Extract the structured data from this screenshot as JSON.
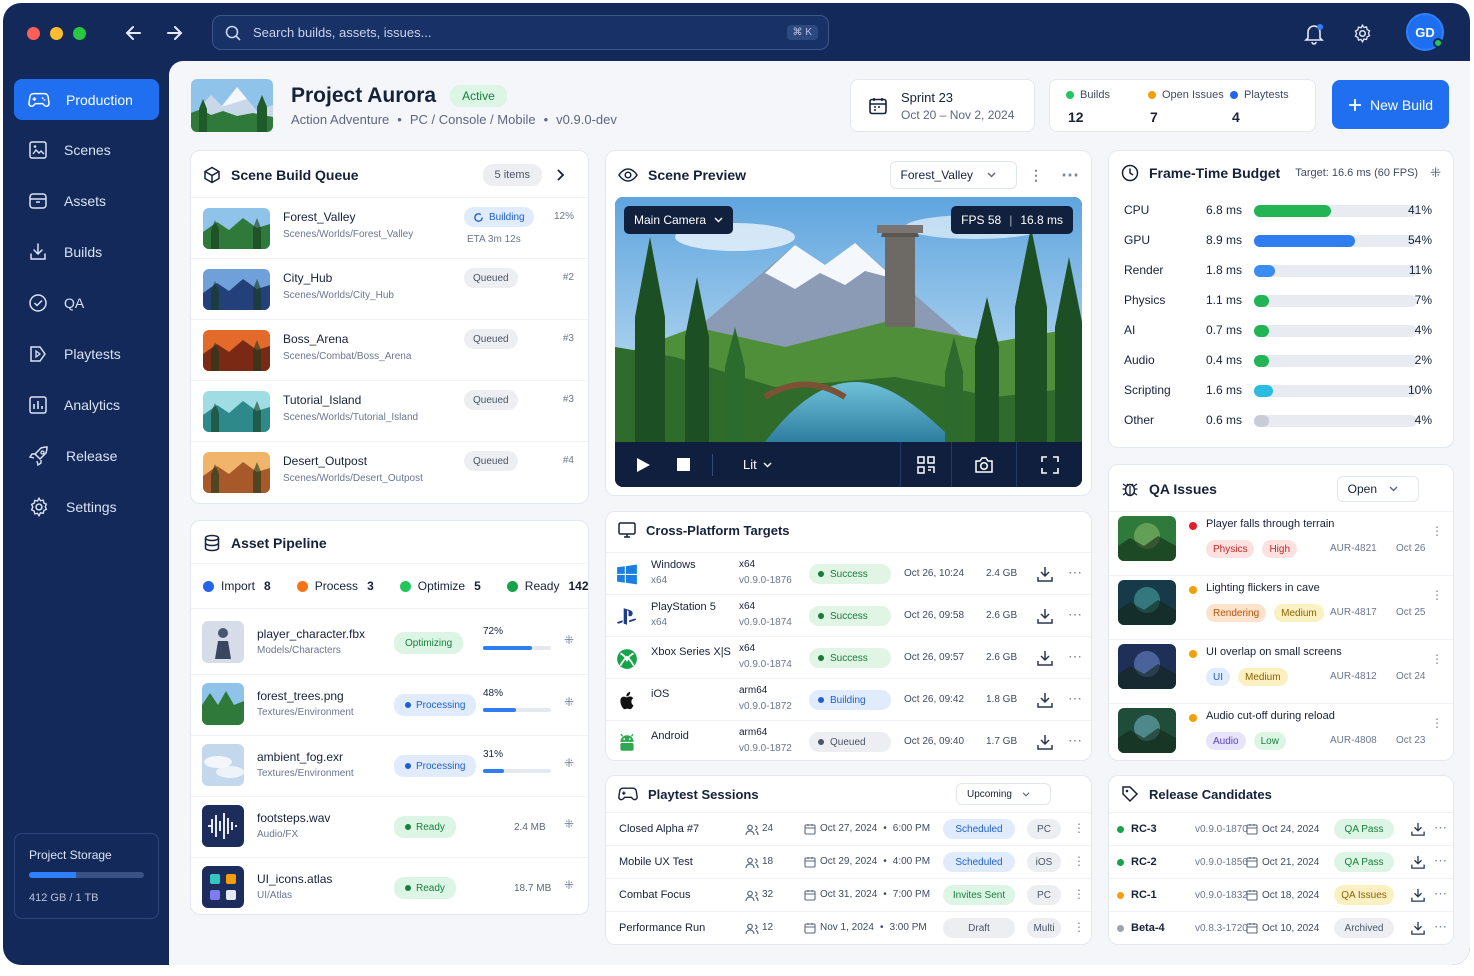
{
  "window": {
    "dot_colors": [
      "#ff5f57",
      "#febc2e",
      "#28c840"
    ]
  },
  "search": {
    "placeholder": "Search builds, assets, issues...",
    "shortcut": "⌘ K"
  },
  "user": {
    "initials": "GD"
  },
  "sidebar": {
    "items": [
      {
        "label": "Production",
        "icon": "gamepad-icon"
      },
      {
        "label": "Scenes",
        "icon": "scenes-icon"
      },
      {
        "label": "Assets",
        "icon": "assets-icon"
      },
      {
        "label": "Builds",
        "icon": "builds-icon"
      },
      {
        "label": "QA",
        "icon": "qa-icon"
      },
      {
        "label": "Playtests",
        "icon": "playtests-icon"
      },
      {
        "label": "Analytics",
        "icon": "analytics-icon"
      },
      {
        "label": "Release",
        "icon": "rocket-icon"
      },
      {
        "label": "Settings",
        "icon": "gear-icon"
      }
    ],
    "storage": {
      "label": "Project Storage",
      "value": "412 GB / 1 TB",
      "fraction": 0.412
    }
  },
  "project": {
    "name": "Project Aurora",
    "status": "Active",
    "genre": "Action Adventure",
    "platforms": "PC / Console / Mobile",
    "version": "v0.9.0-dev"
  },
  "sprint": {
    "name": "Sprint 23",
    "dates": "Oct 20 – Nov 2, 2024"
  },
  "stats": [
    {
      "label": "Builds",
      "value": "12",
      "color": "#22c55e"
    },
    {
      "label": "Open Issues",
      "value": "7",
      "color": "#f59e0b"
    },
    {
      "label": "Playtests",
      "value": "4",
      "color": "#2563eb"
    }
  ],
  "new_build": "New Build",
  "queue": {
    "title": "Scene Build Queue",
    "count": "5 items",
    "items": [
      {
        "name": "Forest_Valley",
        "path": "Scenes/Worlds/Forest_Valley",
        "status": "Building",
        "meta": "12%",
        "eta": "ETA 3m 12s"
      },
      {
        "name": "City_Hub",
        "path": "Scenes/Worlds/City_Hub",
        "status": "Queued",
        "meta": "#2",
        "eta": ""
      },
      {
        "name": "Boss_Arena",
        "path": "Scenes/Combat/Boss_Arena",
        "status": "Queued",
        "meta": "#3",
        "eta": ""
      },
      {
        "name": "Tutorial_Island",
        "path": "Scenes/Worlds/Tutorial_Island",
        "status": "Queued",
        "meta": "#3",
        "eta": ""
      },
      {
        "name": "Desert_Outpost",
        "path": "Scenes/Worlds/Desert_Outpost",
        "status": "Queued",
        "meta": "#4",
        "eta": ""
      }
    ]
  },
  "preview": {
    "title": "Scene Preview",
    "scene": "Forest_Valley",
    "camera": "Main Camera",
    "fps": "FPS 58",
    "ms": "16.8 ms",
    "mode": "Lit"
  },
  "budget": {
    "title": "Frame-Time Budget",
    "target": "Target: 16.6 ms (60 FPS)",
    "rows": [
      {
        "label": "CPU",
        "ms": "6.8 ms",
        "pct": "41%",
        "frac": 0.41,
        "color": "#22b455"
      },
      {
        "label": "GPU",
        "ms": "8.9 ms",
        "pct": "54%",
        "frac": 0.54,
        "color": "#2f7df0"
      },
      {
        "label": "Render",
        "ms": "1.8 ms",
        "pct": "11%",
        "frac": 0.11,
        "color": "#3b8cf5"
      },
      {
        "label": "Physics",
        "ms": "1.1 ms",
        "pct": "7%",
        "frac": 0.07,
        "color": "#22b455"
      },
      {
        "label": "AI",
        "ms": "0.7 ms",
        "pct": "4%",
        "frac": 0.04,
        "color": "#22b455"
      },
      {
        "label": "Audio",
        "ms": "0.4 ms",
        "pct": "2%",
        "frac": 0.02,
        "color": "#22b455"
      },
      {
        "label": "Scripting",
        "ms": "1.6 ms",
        "pct": "10%",
        "frac": 0.1,
        "color": "#2bbde0"
      },
      {
        "label": "Other",
        "ms": "0.6 ms",
        "pct": "4%",
        "frac": 0.04,
        "color": "#c8ccd6"
      }
    ]
  },
  "pipeline": {
    "title": "Asset Pipeline",
    "stages": [
      {
        "label": "Import",
        "count": "8",
        "color": "#2563eb"
      },
      {
        "label": "Process",
        "count": "3",
        "color": "#f97316"
      },
      {
        "label": "Optimize",
        "count": "5",
        "color": "#22c55e"
      },
      {
        "label": "Ready",
        "count": "142",
        "color": "#16a34a"
      }
    ],
    "items": [
      {
        "name": "player_character.fbx",
        "path": "Models/Characters",
        "status": "Optimizing",
        "pct": "72%",
        "frac": 0.72,
        "size": ""
      },
      {
        "name": "forest_trees.png",
        "path": "Textures/Environment",
        "status": "Processing",
        "pct": "48%",
        "frac": 0.48,
        "size": ""
      },
      {
        "name": "ambient_fog.exr",
        "path": "Textures/Environment",
        "status": "Processing",
        "pct": "31%",
        "frac": 0.31,
        "size": ""
      },
      {
        "name": "footsteps.wav",
        "path": "Audio/FX",
        "status": "Ready",
        "pct": "",
        "frac": 0,
        "size": "2.4 MB"
      },
      {
        "name": "UI_icons.atlas",
        "path": "UI/Atlas",
        "status": "Ready",
        "pct": "",
        "frac": 0,
        "size": "18.7 MB"
      }
    ]
  },
  "targets": {
    "title": "Cross-Platform Targets",
    "rows": [
      {
        "platform": "Windows",
        "sub": "x64",
        "arch": "x64",
        "build": "v0.9.0-1876",
        "status": "Success",
        "time": "Oct 26, 10:24",
        "size": "2.4 GB",
        "icon": "windows-icon"
      },
      {
        "platform": "PlayStation 5",
        "sub": "x64",
        "arch": "x64",
        "build": "v0.9.0-1874",
        "status": "Success",
        "time": "Oct 26, 09:58",
        "size": "2.6 GB",
        "icon": "playstation-icon"
      },
      {
        "platform": "Xbox Series X|S",
        "sub": "",
        "arch": "x64",
        "build": "v0.9.0-1874",
        "status": "Success",
        "time": "Oct 26, 09:57",
        "size": "2.6 GB",
        "icon": "xbox-icon"
      },
      {
        "platform": "iOS",
        "sub": "",
        "arch": "arm64",
        "build": "v0.9.0-1872",
        "status": "Building",
        "time": "Oct 26, 09:42",
        "size": "1.8 GB",
        "icon": "apple-icon"
      },
      {
        "platform": "Android",
        "sub": "",
        "arch": "arm64",
        "build": "v0.9.0-1872",
        "status": "Queued",
        "time": "Oct 26, 09:40",
        "size": "1.7 GB",
        "icon": "android-icon"
      }
    ]
  },
  "qa": {
    "title": "QA Issues",
    "filter": "Open",
    "items": [
      {
        "title": "Player falls through terrain",
        "dot": "#e11d2e",
        "tags": [
          {
            "t": "Physics",
            "c": "p-red"
          },
          {
            "t": "High",
            "c": "p-red"
          }
        ],
        "id": "AUR-4821",
        "date": "Oct 26"
      },
      {
        "title": "Lighting flickers in cave",
        "dot": "#f59e0b",
        "tags": [
          {
            "t": "Rendering",
            "c": "p-orange"
          },
          {
            "t": "Medium",
            "c": "p-yellow"
          }
        ],
        "id": "AUR-4817",
        "date": "Oct 25"
      },
      {
        "title": "UI overlap on small screens",
        "dot": "#f59e0b",
        "tags": [
          {
            "t": "UI",
            "c": "p-blue"
          },
          {
            "t": "Medium",
            "c": "p-yellow"
          }
        ],
        "id": "AUR-4812",
        "date": "Oct 24"
      },
      {
        "title": "Audio cut-off during reload",
        "dot": "#f59e0b",
        "tags": [
          {
            "t": "Audio",
            "c": "p-purple"
          },
          {
            "t": "Low",
            "c": "p-green"
          }
        ],
        "id": "AUR-4808",
        "date": "Oct 23"
      }
    ]
  },
  "playtests": {
    "title": "Playtest Sessions",
    "filter": "Upcoming",
    "rows": [
      {
        "name": "Closed Alpha #7",
        "people": "24",
        "date": "Oct 27, 2024",
        "time": "6:00 PM",
        "status": "Scheduled",
        "platform": "PC"
      },
      {
        "name": "Mobile UX Test",
        "people": "18",
        "date": "Oct 29, 2024",
        "time": "4:00 PM",
        "status": "Scheduled",
        "platform": "iOS"
      },
      {
        "name": "Combat Focus",
        "people": "32",
        "date": "Oct 31, 2024",
        "time": "7:00 PM",
        "status": "Invites Sent",
        "platform": "PC"
      },
      {
        "name": "Performance Run",
        "people": "12",
        "date": "Nov 1, 2024",
        "time": "3:00 PM",
        "status": "Draft",
        "platform": "Multi"
      }
    ]
  },
  "releases": {
    "title": "Release Candidates",
    "rows": [
      {
        "name": "RC-3",
        "build": "v0.9.0-1870",
        "date": "Oct 24, 2024",
        "status": "QA Pass",
        "dot": "#16a34a"
      },
      {
        "name": "RC-2",
        "build": "v0.9.0-1856",
        "date": "Oct 21, 2024",
        "status": "QA Pass",
        "dot": "#16a34a"
      },
      {
        "name": "RC-1",
        "build": "v0.9.0-1832",
        "date": "Oct 18, 2024",
        "status": "QA Issues",
        "dot": "#f59e0b"
      },
      {
        "name": "Beta-4",
        "build": "v0.8.3-1720",
        "date": "Oct 10, 2024",
        "status": "Archived",
        "dot": "#9ca3af"
      }
    ]
  }
}
